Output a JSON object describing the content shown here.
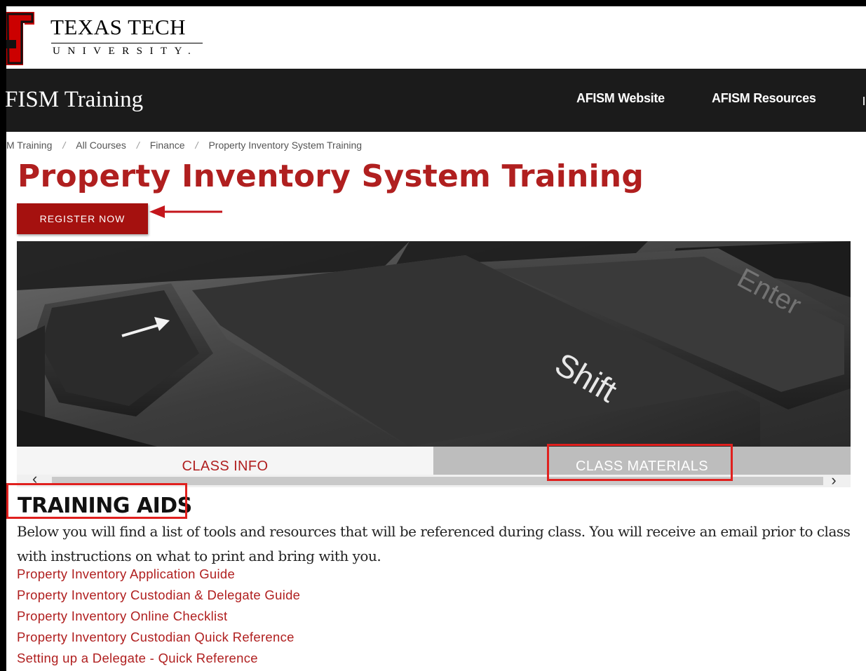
{
  "logo": {
    "name_line1": "TEXAS TECH",
    "name_line2": "UNIVERSITY."
  },
  "navbar": {
    "site_title": "FISM Training",
    "links": [
      "AFISM Website",
      "AFISM Resources"
    ]
  },
  "breadcrumb": [
    "M Training",
    "All Courses",
    "Finance",
    "Property Inventory System Training"
  ],
  "page": {
    "title": "Property Inventory System Training",
    "register_label": "REGISTER NOW"
  },
  "hero": {
    "key_shift": "Shift",
    "key_enter": "Enter"
  },
  "tabs": {
    "info": "CLASS INFO",
    "materials": "CLASS MATERIALS",
    "prev_arrow": "‹",
    "next_arrow": "›"
  },
  "section": {
    "heading": "TRAINING AIDS",
    "intro": "Below you will find a list of tools and resources that will be referenced during class. You will receive an email prior to class with instructions on what to print and bring with you.",
    "links": [
      "Property Inventory Application Guide",
      "Property Inventory Custodian & Delegate Guide",
      "Property Inventory Online Checklist",
      "Property Inventory Custodian Quick Reference",
      "Setting up a Delegate - Quick Reference"
    ]
  },
  "colors": {
    "brand_red": "#b01f1f",
    "button_red": "#a5110f",
    "navbar": "#1b1b1b",
    "annotation_red": "#e0201e"
  }
}
